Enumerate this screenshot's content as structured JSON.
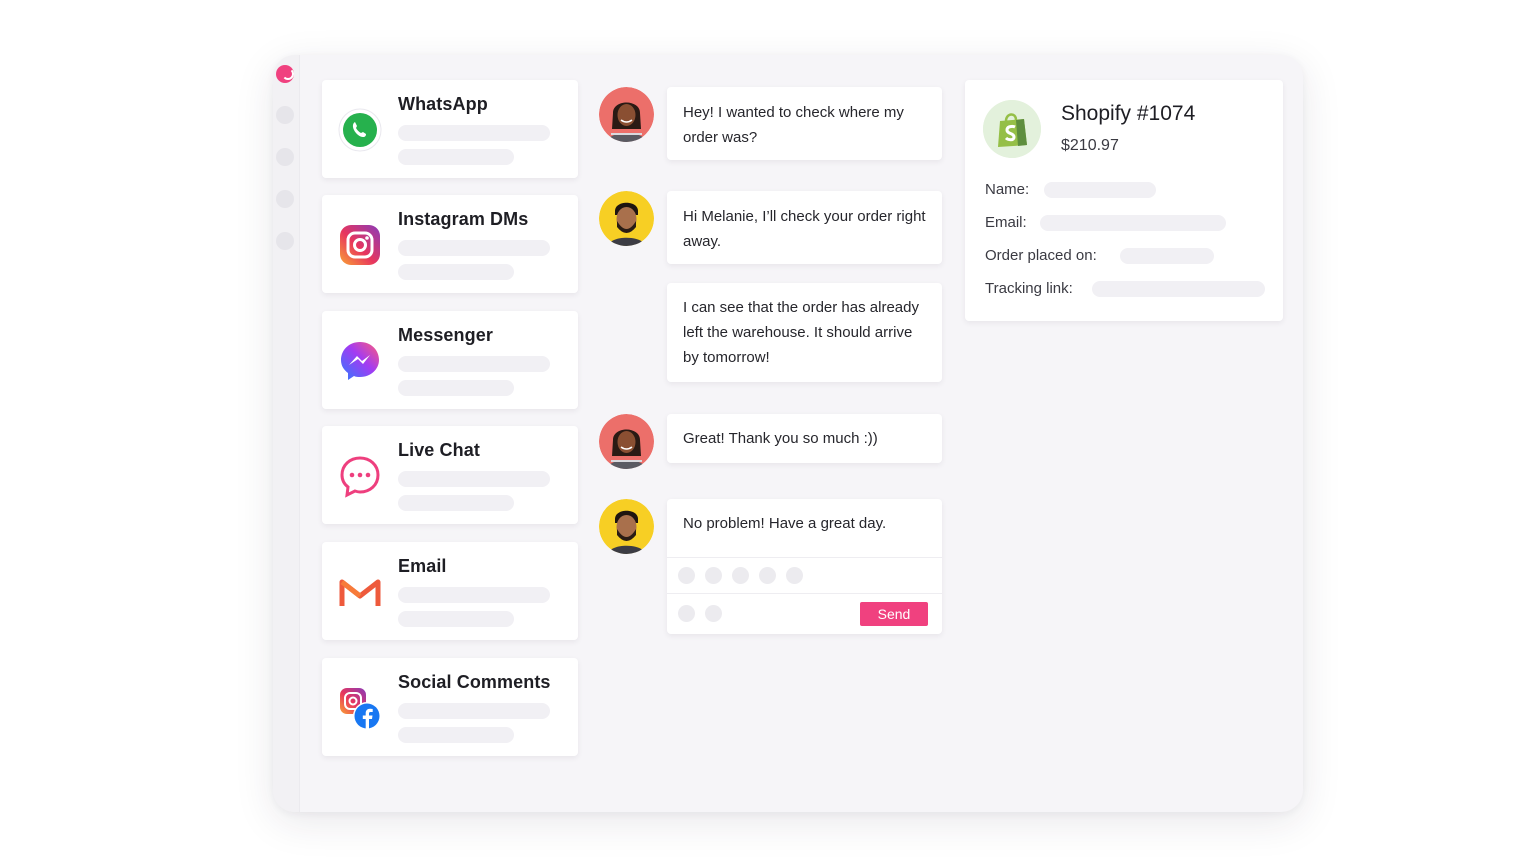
{
  "brand": {
    "accent": "#f0417f",
    "skeleton": "#f1f0f4",
    "background": "#f6f5f8"
  },
  "rail": {
    "logo_icon": "app-logo-icon",
    "nav_dots": 4
  },
  "channels": [
    {
      "label": "WhatsApp",
      "icon": "whatsapp-icon"
    },
    {
      "label": "Instagram DMs",
      "icon": "instagram-icon"
    },
    {
      "label": "Messenger",
      "icon": "messenger-icon"
    },
    {
      "label": "Live Chat",
      "icon": "live-chat-icon"
    },
    {
      "label": "Email",
      "icon": "gmail-icon"
    },
    {
      "label": "Social Comments",
      "icon": "social-comments-icon"
    }
  ],
  "conversation": {
    "messages": [
      {
        "from": "customer",
        "text": "Hey! I wanted to check where my order was?"
      },
      {
        "from": "agent",
        "text": "Hi Melanie, I’ll check your order right away."
      },
      {
        "from": "agent",
        "text": "I can see that the order has already left the warehouse. It should arrive by tomorrow!"
      },
      {
        "from": "customer",
        "text": "Great! Thank you so much :))"
      }
    ],
    "composer": {
      "draft": "No problem! Have a great day.",
      "send_label": "Send"
    }
  },
  "order": {
    "title": "Shopify #1074",
    "amount": "$210.97",
    "icon": "shopify-bag-icon",
    "fields": [
      {
        "label": "Name:"
      },
      {
        "label": "Email:"
      },
      {
        "label": "Order placed on:"
      },
      {
        "label": "Tracking link:"
      }
    ]
  }
}
